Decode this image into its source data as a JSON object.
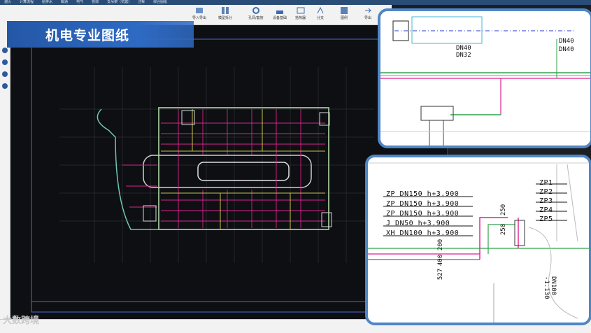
{
  "title": "机电专业图纸",
  "ribbon": {
    "tabs": [
      "遍历",
      "计算流程",
      "给排水",
      "暖通",
      "电气",
      "管综",
      "支吊架（抗震)",
      "注释",
      "综合图纸"
    ],
    "buttons": [
      "导入导出",
      "模型拆分",
      "孔洞/套管",
      "设备基础",
      "拾热器",
      "分支",
      "图例",
      "导出"
    ]
  },
  "watermark": "大数跨境",
  "detail1": {
    "labels": [
      "DN40",
      "DN32",
      "DN40",
      "DN40"
    ]
  },
  "detail2": {
    "pipe_lines": [
      "ZP DN150 h+3.900",
      "ZP DN150 h+3.900",
      "ZP DN150 h+3.900",
      "J DN50 h+3.900",
      "XH DN100 h+3.900"
    ],
    "zp_tags": [
      "ZP1",
      "ZP2",
      "ZP3",
      "ZP4",
      "ZP5"
    ],
    "dims": [
      "250",
      "250",
      "400",
      "200",
      "527"
    ],
    "right_label": "DN100 -1.130"
  },
  "colors": {
    "accent": "#2f6ac3",
    "frame": "#4f86c6",
    "pipe_magenta": "#e0208f",
    "pipe_green": "#2fa34a"
  }
}
